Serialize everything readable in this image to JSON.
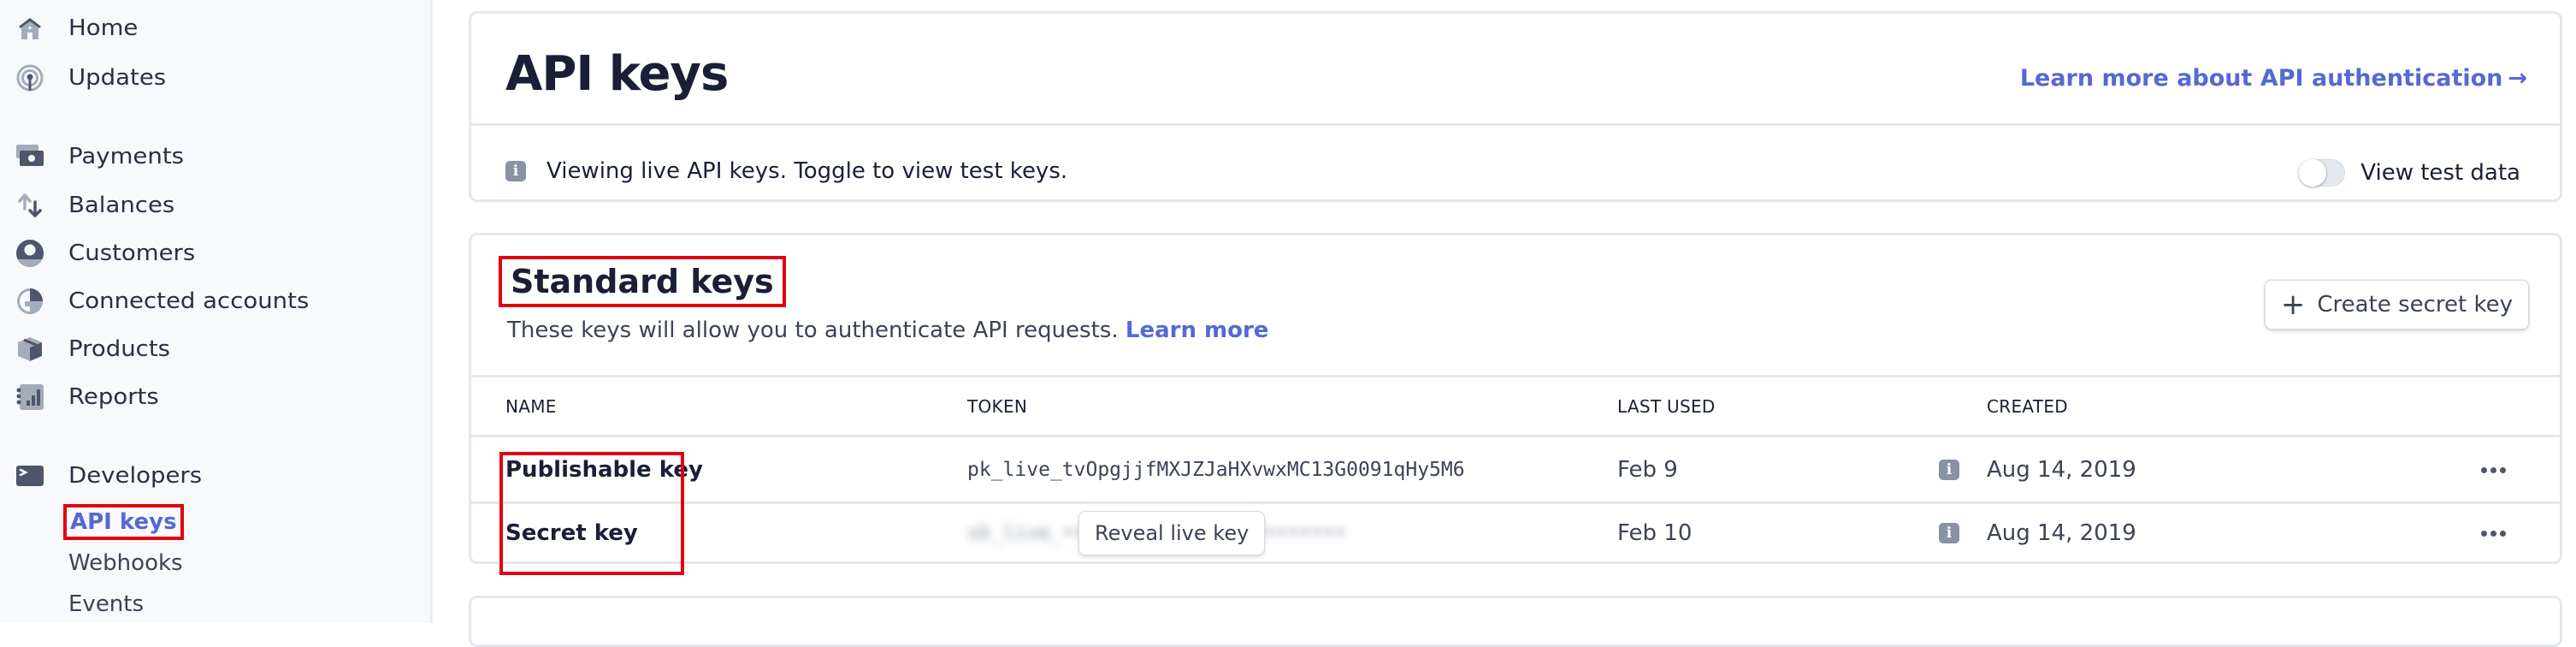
{
  "sidebar": {
    "items": [
      {
        "label": "Home",
        "icon": "home-icon"
      },
      {
        "label": "Updates",
        "icon": "broadcast-icon"
      },
      {
        "label": "Payments",
        "icon": "payments-icon"
      },
      {
        "label": "Balances",
        "icon": "balances-icon"
      },
      {
        "label": "Customers",
        "icon": "customer-icon"
      },
      {
        "label": "Connected accounts",
        "icon": "connected-accounts-icon"
      },
      {
        "label": "Products",
        "icon": "product-box-icon"
      },
      {
        "label": "Reports",
        "icon": "reports-icon"
      },
      {
        "label": "Developers",
        "icon": "terminal-icon"
      }
    ],
    "developer_subitems": [
      {
        "label": "API keys",
        "active": true
      },
      {
        "label": "Webhooks",
        "active": false
      },
      {
        "label": "Events",
        "active": false
      }
    ]
  },
  "header": {
    "title": "API keys",
    "auth_link": "Learn more about API authentication",
    "auth_link_arrow": "→",
    "notice": "Viewing live API keys. Toggle to view test keys.",
    "toggle_label": "View test data",
    "toggle_on": false
  },
  "standard_keys": {
    "title": "Standard keys",
    "description": "These keys will allow you to authenticate API requests.",
    "learn_more": "Learn more",
    "create_button": "Create secret key",
    "columns": [
      "NAME",
      "TOKEN",
      "LAST USED",
      "CREATED"
    ],
    "rows": [
      {
        "name": "Publishable key",
        "token": "pk_live_tvOpgjjfMXJZJaHXvwxMC13G0091qHy5M6",
        "last_used": "Feb 9",
        "created": "Aug 14, 2019"
      },
      {
        "name": "Secret key",
        "token_masked": "sk_live_••••••••••••••••••••••••",
        "reveal_button": "Reveal live key",
        "last_used": "Feb 10",
        "created": "Aug 14, 2019"
      }
    ]
  },
  "colors": {
    "accent": "#5469d4",
    "highlight_box": "#e3000f",
    "sidebar_bg": "#f7f9fc",
    "text_primary": "#1a1f36",
    "icon_gray": "#8792a2"
  }
}
